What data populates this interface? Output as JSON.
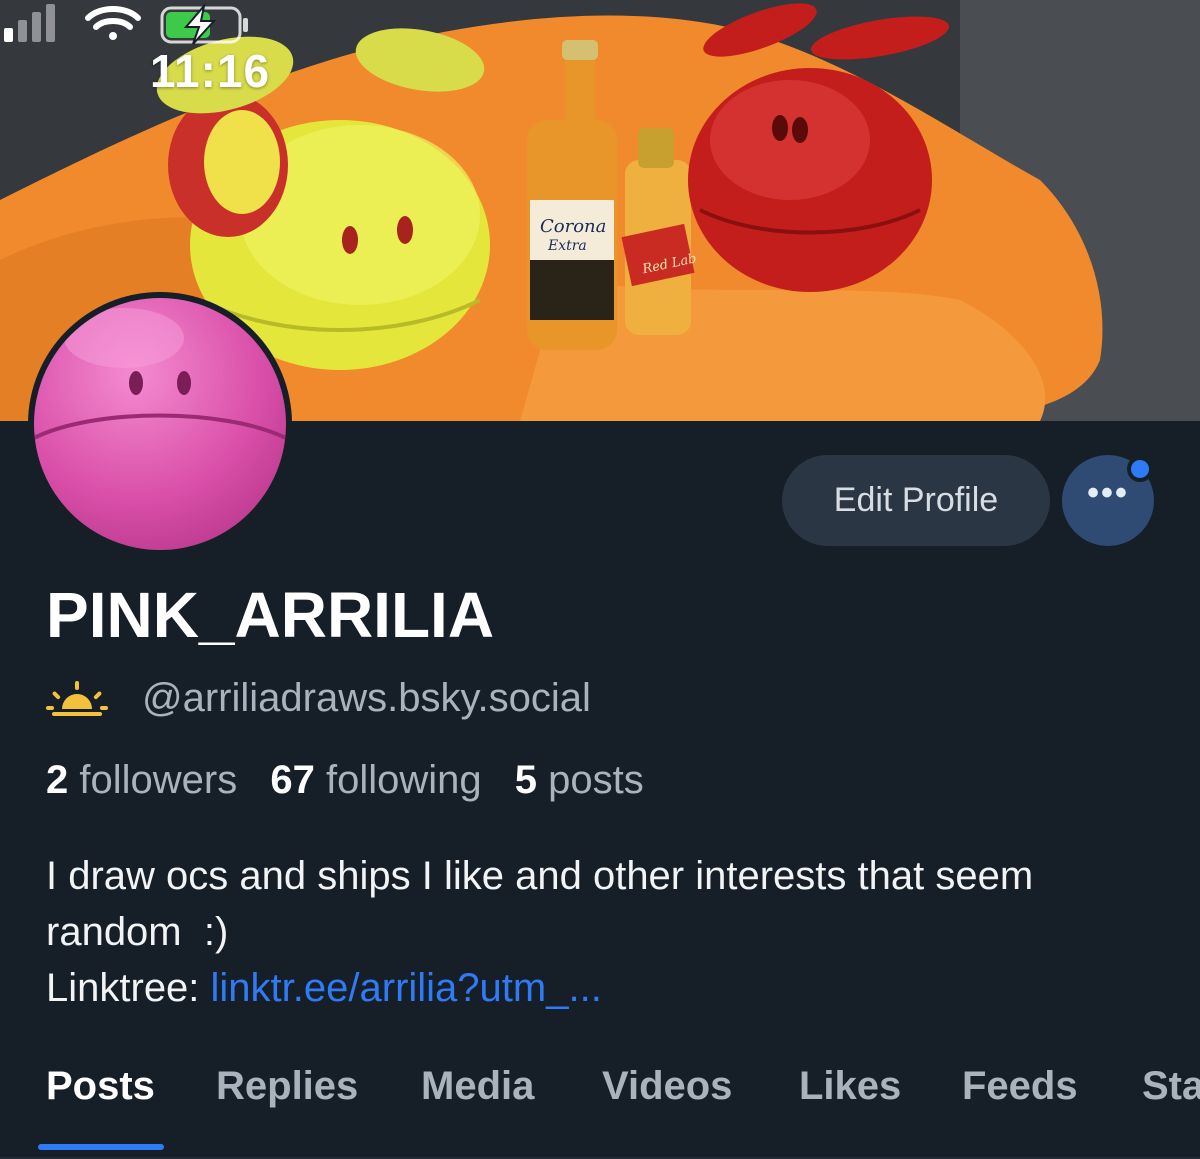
{
  "status_bar": {
    "time": "11:16",
    "icons": [
      "signal-icon",
      "wifi-icon",
      "battery-charging-icon"
    ]
  },
  "banner": {
    "bottle_label_1": "Corona",
    "bottle_label_1b": "Extra",
    "bottle_label_2": "Red Lab"
  },
  "profile": {
    "display_name": "PINK_ARRILIA",
    "handle_icon": "sunrise-icon",
    "handle": "@arriliadraws.bsky.social",
    "followers_count": "2",
    "followers_label": "followers",
    "following_count": "67",
    "following_label": "following",
    "posts_count": "5",
    "posts_label": "posts",
    "bio_line1": "I draw ocs and ships I like and other interests that seem",
    "bio_line2": "random  :)",
    "bio_link_label": "Linktree: ",
    "bio_link": "linktr.ee/arrilia?utm_..."
  },
  "actions": {
    "edit_profile": "Edit Profile",
    "more": "•••"
  },
  "tabs": [
    {
      "label": "Posts",
      "active": true
    },
    {
      "label": "Replies",
      "active": false
    },
    {
      "label": "Media",
      "active": false
    },
    {
      "label": "Videos",
      "active": false
    },
    {
      "label": "Likes",
      "active": false
    },
    {
      "label": "Feeds",
      "active": false
    },
    {
      "label": "Sta",
      "active": false
    }
  ],
  "colors": {
    "background": "#161e27",
    "accent": "#2f7bf6",
    "muted_text": "#a9b2bd",
    "button_bg": "#2a3644"
  }
}
